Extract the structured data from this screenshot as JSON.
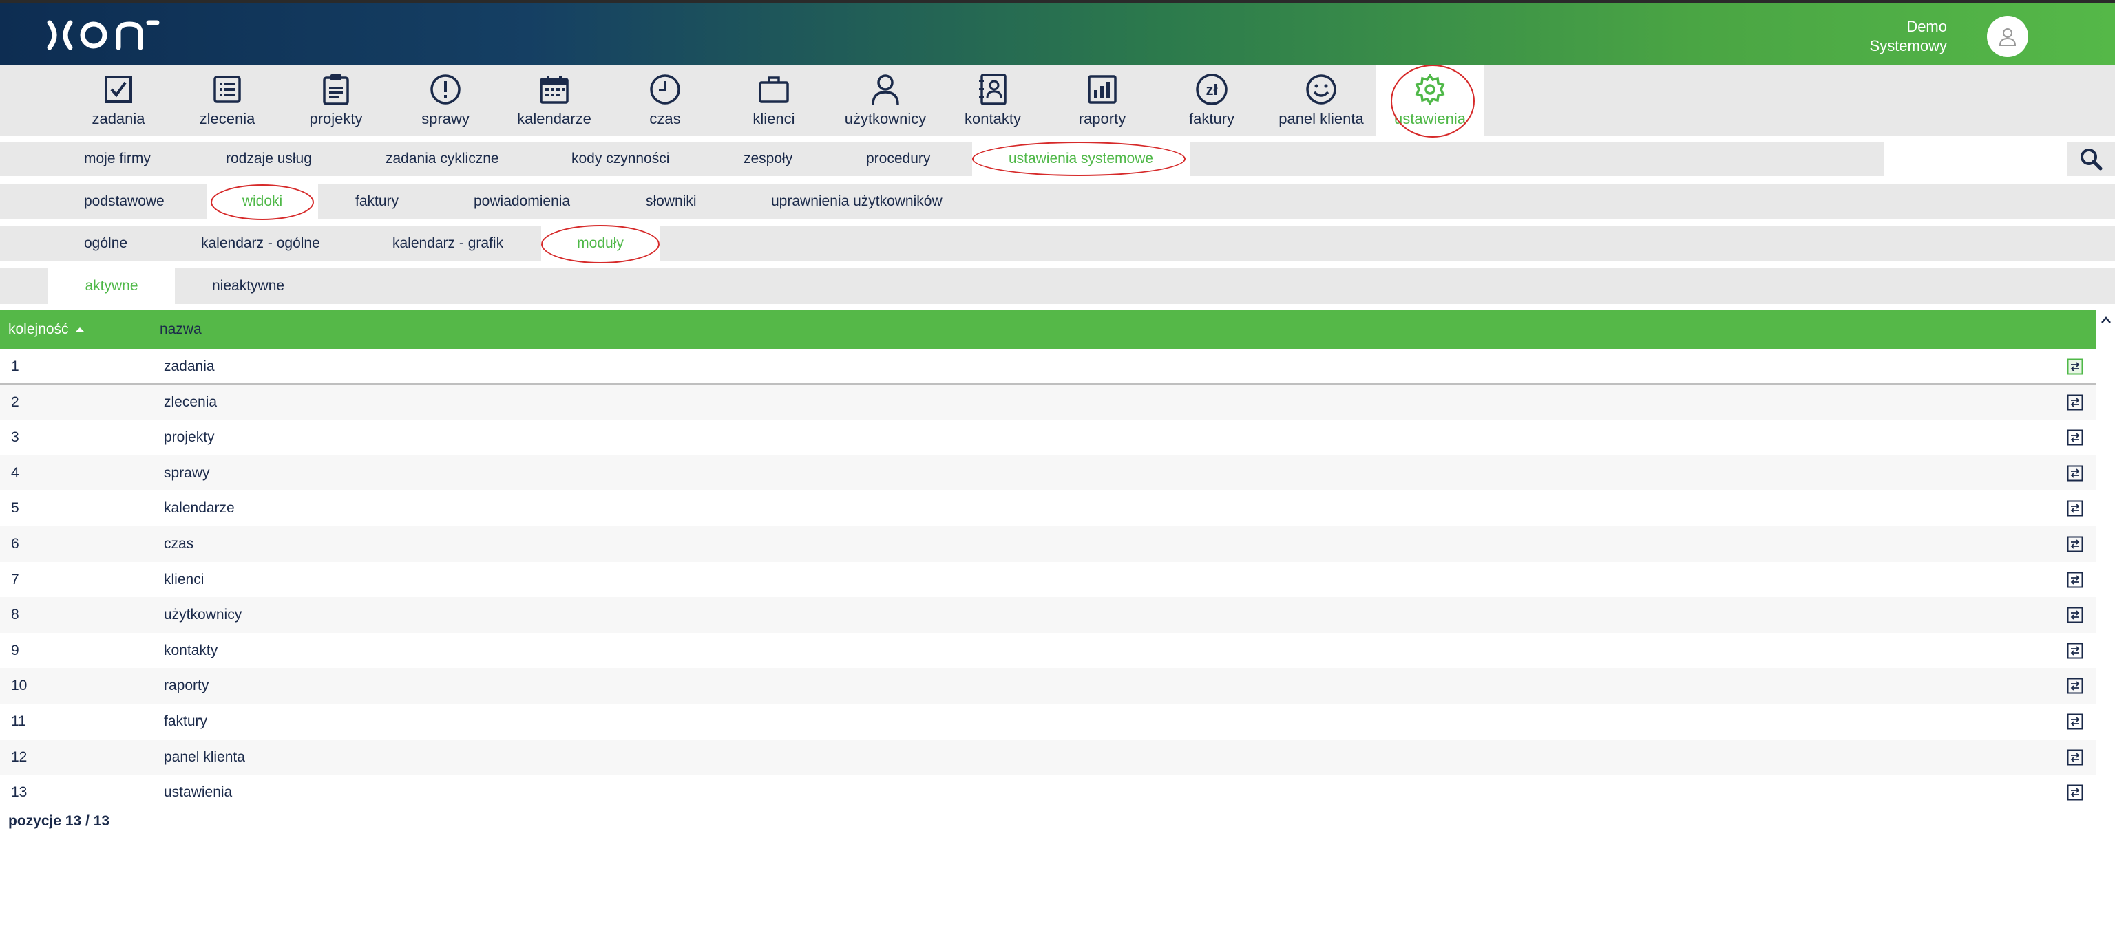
{
  "header": {
    "user_line1": "Demo",
    "user_line2": "Systemowy"
  },
  "main_nav": [
    {
      "label": "zadania",
      "icon": "checkbox-icon"
    },
    {
      "label": "zlecenia",
      "icon": "list-icon"
    },
    {
      "label": "projekty",
      "icon": "clipboard-icon"
    },
    {
      "label": "sprawy",
      "icon": "exclamation-icon"
    },
    {
      "label": "kalendarze",
      "icon": "calendar-icon"
    },
    {
      "label": "czas",
      "icon": "clock-icon"
    },
    {
      "label": "klienci",
      "icon": "briefcase-icon"
    },
    {
      "label": "użytkownicy",
      "icon": "user-icon"
    },
    {
      "label": "kontakty",
      "icon": "contact-book-icon"
    },
    {
      "label": "raporty",
      "icon": "bar-chart-icon"
    },
    {
      "label": "faktury",
      "icon": "zloty-icon"
    },
    {
      "label": "panel klienta",
      "icon": "smiley-icon"
    },
    {
      "label": "ustawienia",
      "icon": "gear-icon",
      "active": true
    }
  ],
  "subnav1": {
    "items": [
      "moje firmy",
      "rodzaje usług",
      "zadania cykliczne",
      "kody czynności",
      "zespoły",
      "procedury",
      "ustawienia systemowe"
    ],
    "active": "ustawienia systemowe"
  },
  "subnav2": {
    "items": [
      "podstawowe",
      "widoki",
      "faktury",
      "powiadomienia",
      "słowniki",
      "uprawnienia użytkowników"
    ],
    "active": "widoki"
  },
  "subnav3": {
    "items": [
      "ogólne",
      "kalendarz - ogólne",
      "kalendarz - grafik",
      "moduły"
    ],
    "active": "moduły"
  },
  "tabs": {
    "items": [
      "aktywne",
      "nieaktywne"
    ],
    "active": "aktywne"
  },
  "table": {
    "col_order": "kolejność",
    "col_name": "nazwa",
    "rows": [
      {
        "n": "1",
        "name": "zadania"
      },
      {
        "n": "2",
        "name": "zlecenia"
      },
      {
        "n": "3",
        "name": "projekty"
      },
      {
        "n": "4",
        "name": "sprawy"
      },
      {
        "n": "5",
        "name": "kalendarze"
      },
      {
        "n": "6",
        "name": "czas"
      },
      {
        "n": "7",
        "name": "klienci"
      },
      {
        "n": "8",
        "name": "użytkownicy"
      },
      {
        "n": "9",
        "name": "kontakty"
      },
      {
        "n": "10",
        "name": "raporty"
      },
      {
        "n": "11",
        "name": "faktury"
      },
      {
        "n": "12",
        "name": "panel klienta"
      },
      {
        "n": "13",
        "name": "ustawienia"
      }
    ],
    "footer": "pozycje 13 / 13"
  },
  "colors": {
    "accent": "#55b848",
    "text": "#1b2a4a",
    "annotation": "#d62a2a"
  }
}
